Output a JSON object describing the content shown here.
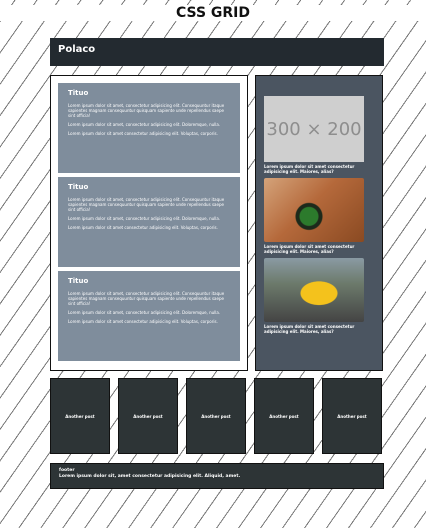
{
  "page": {
    "title": "CSS GRID"
  },
  "header": {
    "brand": "Polaco"
  },
  "main": {
    "cards": [
      {
        "title": "Tituo",
        "p1": "Lorem ipsum dolor sit amet, consectetur adipisicing elit. Consequuntur itaque sapientes magnam consequuntur quisquam sapiente unde repellendus saepe sint officia!",
        "p2": "Lorem ipsum dolor sit amet, consectetur adipisicing elit. Doloremque, nulla.",
        "p3": "Lorem ipsum dolor sit amet consectetur adipisicing elit. Voluptas, corporis."
      },
      {
        "title": "Tituo",
        "p1": "Lorem ipsum dolor sit amet, consectetur adipisicing elit. Consequuntur itaque sapientes magnam consequuntur quisquam sapiente unde repellendus saepe sint officia!",
        "p2": "Lorem ipsum dolor sit amet, consectetur adipisicing elit. Doloremque, nulla.",
        "p3": "Lorem ipsum dolor sit amet consectetur adipisicing elit. Voluptas, corporis."
      },
      {
        "title": "Tituo",
        "p1": "Lorem ipsum dolor sit amet, consectetur adipisicing elit. Consequuntur itaque sapientes magnam consequuntur quisquam sapiente unde repellendus saepe sint officia!",
        "p2": "Lorem ipsum dolor sit amet, consectetur adipisicing elit. Doloremque, nulla.",
        "p3": "Lorem ipsum dolor sit amet consectetur adipisicing elit. Voluptas, corporis."
      }
    ]
  },
  "sidebar": {
    "placeholder_text": "300 × 200",
    "items": [
      {
        "caption": "Lorem ipsum dolor sit amet consectetur adipisicing elit. Maiores, alias?"
      },
      {
        "caption": "Lorem ipsum dolor sit amet consectetur adipisicing elit. Maiores, alias?"
      },
      {
        "caption": "Lorem ipsum dolor sit amet consectetur adipisicing elit. Maiores, alias?"
      }
    ]
  },
  "posts": [
    {
      "label": "Another post"
    },
    {
      "label": "Another post"
    },
    {
      "label": "Another post"
    },
    {
      "label": "Another post"
    },
    {
      "label": "Another post"
    }
  ],
  "footer": {
    "title": "footer",
    "text": "Lorem ipsum dolor sit, amet consectetur adipisicing elit. Aliquid, amet."
  }
}
